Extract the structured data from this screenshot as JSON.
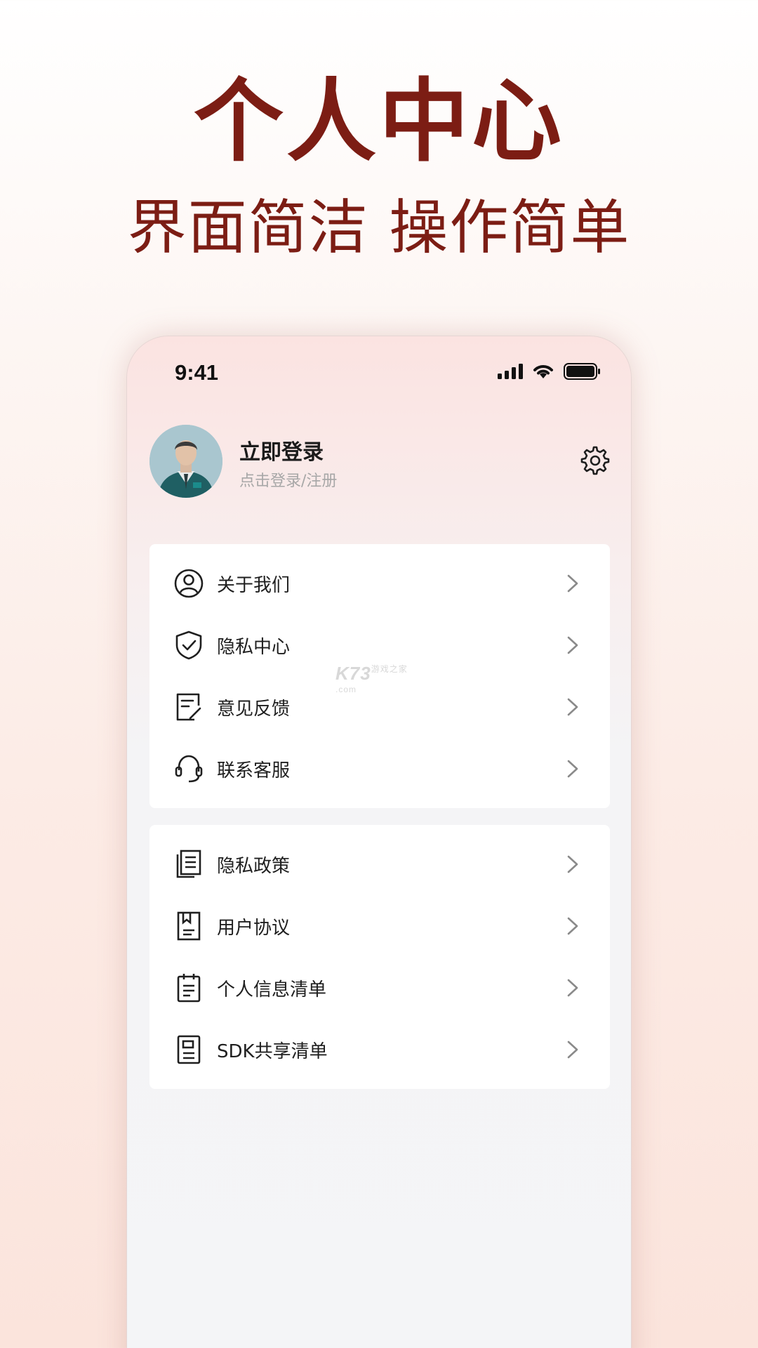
{
  "promo": {
    "title": "个人中心",
    "subtitle": "界面简洁 操作简单"
  },
  "status_bar": {
    "time": "9:41",
    "icons": [
      "signal-icon",
      "wifi-icon",
      "battery-icon"
    ]
  },
  "profile": {
    "title": "立即登录",
    "subtitle": "点击登录/注册",
    "settings_icon": "gear-icon"
  },
  "menu_group_1": [
    {
      "label": "关于我们",
      "icon": "user-circle-icon"
    },
    {
      "label": "隐私中心",
      "icon": "shield-check-icon"
    },
    {
      "label": "意见反馈",
      "icon": "feedback-edit-icon"
    },
    {
      "label": "联系客服",
      "icon": "headset-icon"
    }
  ],
  "menu_group_2": [
    {
      "label": "隐私政策",
      "icon": "documents-icon"
    },
    {
      "label": "用户协议",
      "icon": "bookmark-doc-icon"
    },
    {
      "label": "个人信息清单",
      "icon": "clipboard-icon"
    },
    {
      "label": "SDK共享清单",
      "icon": "sdk-doc-icon"
    }
  ],
  "watermark": {
    "main": "K73",
    "small": "游戏之家 .com"
  },
  "colors": {
    "brand": "#7c1d14",
    "text": "#1f1f1f",
    "muted": "#a7a7a7",
    "chevron": "#8a8a8a"
  }
}
